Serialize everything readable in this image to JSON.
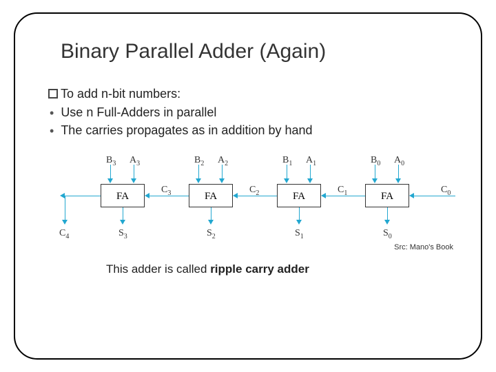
{
  "title": "Binary Parallel Adder (Again)",
  "bullets": {
    "main": "To add n-bit numbers:",
    "sub1": "Use n Full-Adders in parallel",
    "sub2": "The carries propagates as in addition by hand"
  },
  "diagram": {
    "fa": "FA",
    "B3": "B",
    "B3s": "3",
    "A3": "A",
    "A3s": "3",
    "B2": "B",
    "B2s": "2",
    "A2": "A",
    "A2s": "2",
    "B1": "B",
    "B1s": "1",
    "A1": "A",
    "A1s": "1",
    "B0": "B",
    "B0s": "0",
    "A0": "A",
    "A0s": "0",
    "C4": "C",
    "C4s": "4",
    "C3": "C",
    "C3s": "3",
    "C2": "C",
    "C2s": "2",
    "C1": "C",
    "C1s": "1",
    "C0": "C",
    "C0s": "0",
    "S3": "S",
    "S3s": "3",
    "S2": "S",
    "S2s": "2",
    "S1": "S",
    "S1s": "1",
    "S0": "S",
    "S0s": "0"
  },
  "source": "Src: Mano's Book",
  "caption_pre": "This adder is called ",
  "caption_bold": "ripple carry adder"
}
